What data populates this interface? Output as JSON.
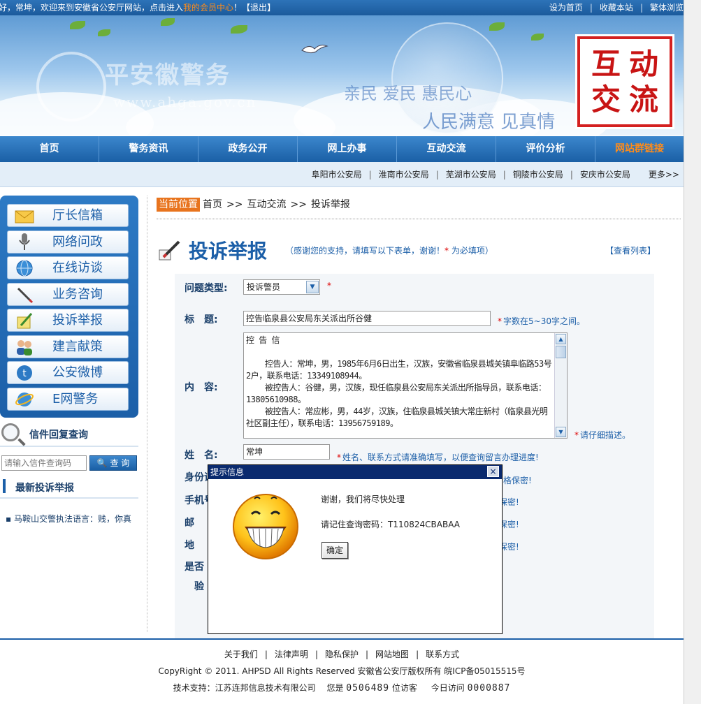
{
  "topbar": {
    "welcome_prefix": "好，常坤，欢迎来到安徽省公安厅网站，点击进入",
    "member_center": "我的会员中心",
    "welcome_mid": "！【",
    "logout": "退出",
    "welcome_end": "】",
    "set_home": "设为首页",
    "favorite": "收藏本站",
    "traditional": "繁体浏览"
  },
  "banner": {
    "site_logo": "平安徽警务",
    "site_url": "www.ahga.gov.cn",
    "slogan1": "亲民 爱民 惠民心",
    "slogan2": "人民满意 见真情",
    "seal_chars": [
      "互",
      "动",
      "交",
      "流"
    ]
  },
  "mainnav": {
    "items": [
      "首页",
      "警务资讯",
      "政务公开",
      "网上办事",
      "互动交流",
      "评价分析",
      "网站群链接"
    ]
  },
  "subnav": {
    "items": [
      "阜阳市公安局",
      "淮南市公安局",
      "芜湖市公安局",
      "铜陵市公安局",
      "安庆市公安局"
    ],
    "more": "更多>>"
  },
  "sidebar": {
    "items": [
      {
        "label": "厅长信箱",
        "icon": "envelope-icon"
      },
      {
        "label": "网络问政",
        "icon": "microphone-icon"
      },
      {
        "label": "在线访谈",
        "icon": "globe-icon"
      },
      {
        "label": "业务咨询",
        "icon": "pen-icon"
      },
      {
        "label": "投诉举报",
        "icon": "pencil-note-icon"
      },
      {
        "label": "建言献策",
        "icon": "people-icon"
      },
      {
        "label": "公安微博",
        "icon": "weibo-icon"
      },
      {
        "label": "E网警务",
        "icon": "ie-icon"
      }
    ],
    "query_title": "信件回复查询",
    "query_placeholder": "请输入信件查询码",
    "query_button": "查 询",
    "latest_title": "最新投诉举报",
    "latest_items": [
      "马鞍山交警执法语言：贱，你真"
    ]
  },
  "breadcrumb": {
    "badge": "当前位置",
    "items": [
      "首页",
      "互动交流",
      "投诉举报"
    ],
    "sep": ">>"
  },
  "page_head": {
    "title": "投诉举报",
    "note_pre": "（感谢您的支持，请填写以下表单，谢谢！",
    "note_star": "*",
    "note_post": " 为必填项）",
    "list_link": "【查看列表】"
  },
  "form": {
    "type_label": "问题类型:",
    "type_value": "投诉警员",
    "title_label": "标　题:",
    "title_value": "控告临泉县公安局东关派出所谷健",
    "title_hint": "字数在5~30字之间。",
    "content_label": "内　容:",
    "content_value": "控 告 信\n\n    控告人：常坤，男，1985年6月6日出生，汉族，安徽省临泉县城关镇阜临路53号2户，联系电话：13349108944。\n    被控告人：谷健，男，汉族，现任临泉县公安局东关派出所指导员，联系电话：13805610988。\n    被控告人：常应彬，男，44岁，汉族，住临泉县城关镇大常庄新村（临泉县光明社区副主任），联系电话：13956759189。\n\n控告请求：",
    "content_hint": "请仔细描述。",
    "name_label": "姓　名:",
    "name_value": "常坤",
    "name_hint": "姓名、联系方式请准确填写，以便查询留言办理进度!",
    "id_label": "身份证",
    "id_hint_tail": "严格保密!",
    "phone_label": "手机号",
    "phone_hint_tail": "保密!",
    "email_label": "邮",
    "email_hint_tail": "保密!",
    "address_label": "地",
    "address_hint_tail": "保密!",
    "public_label": "是否",
    "verify_label": "验"
  },
  "modal": {
    "title": "提示信息",
    "close": "×",
    "message": "谢谢，我们将尽快处理",
    "password_text": "请记住查询密码：T110824CBABAA",
    "ok": "确定"
  },
  "footer": {
    "links": [
      "关于我们",
      "法律声明",
      "隐私保护",
      "网站地图",
      "联系方式"
    ],
    "copyright": "CopyRight © 2011. AHPSD All Rights Reserved   安徽省公安厅版权所有   皖ICP备05015515号",
    "support": "技术支持：江苏连邦信息技术有限公司",
    "visitor_pre": "您是",
    "visitor_count": "0506489",
    "visitor_post": "位访客",
    "today_pre": "今日访问",
    "today_count": "0000887"
  },
  "colors": {
    "brand_blue": "#1c5fa8",
    "accent_orange": "#ff8c1a",
    "required_red": "#dd0000",
    "modal_title": "#0a2a6e"
  }
}
